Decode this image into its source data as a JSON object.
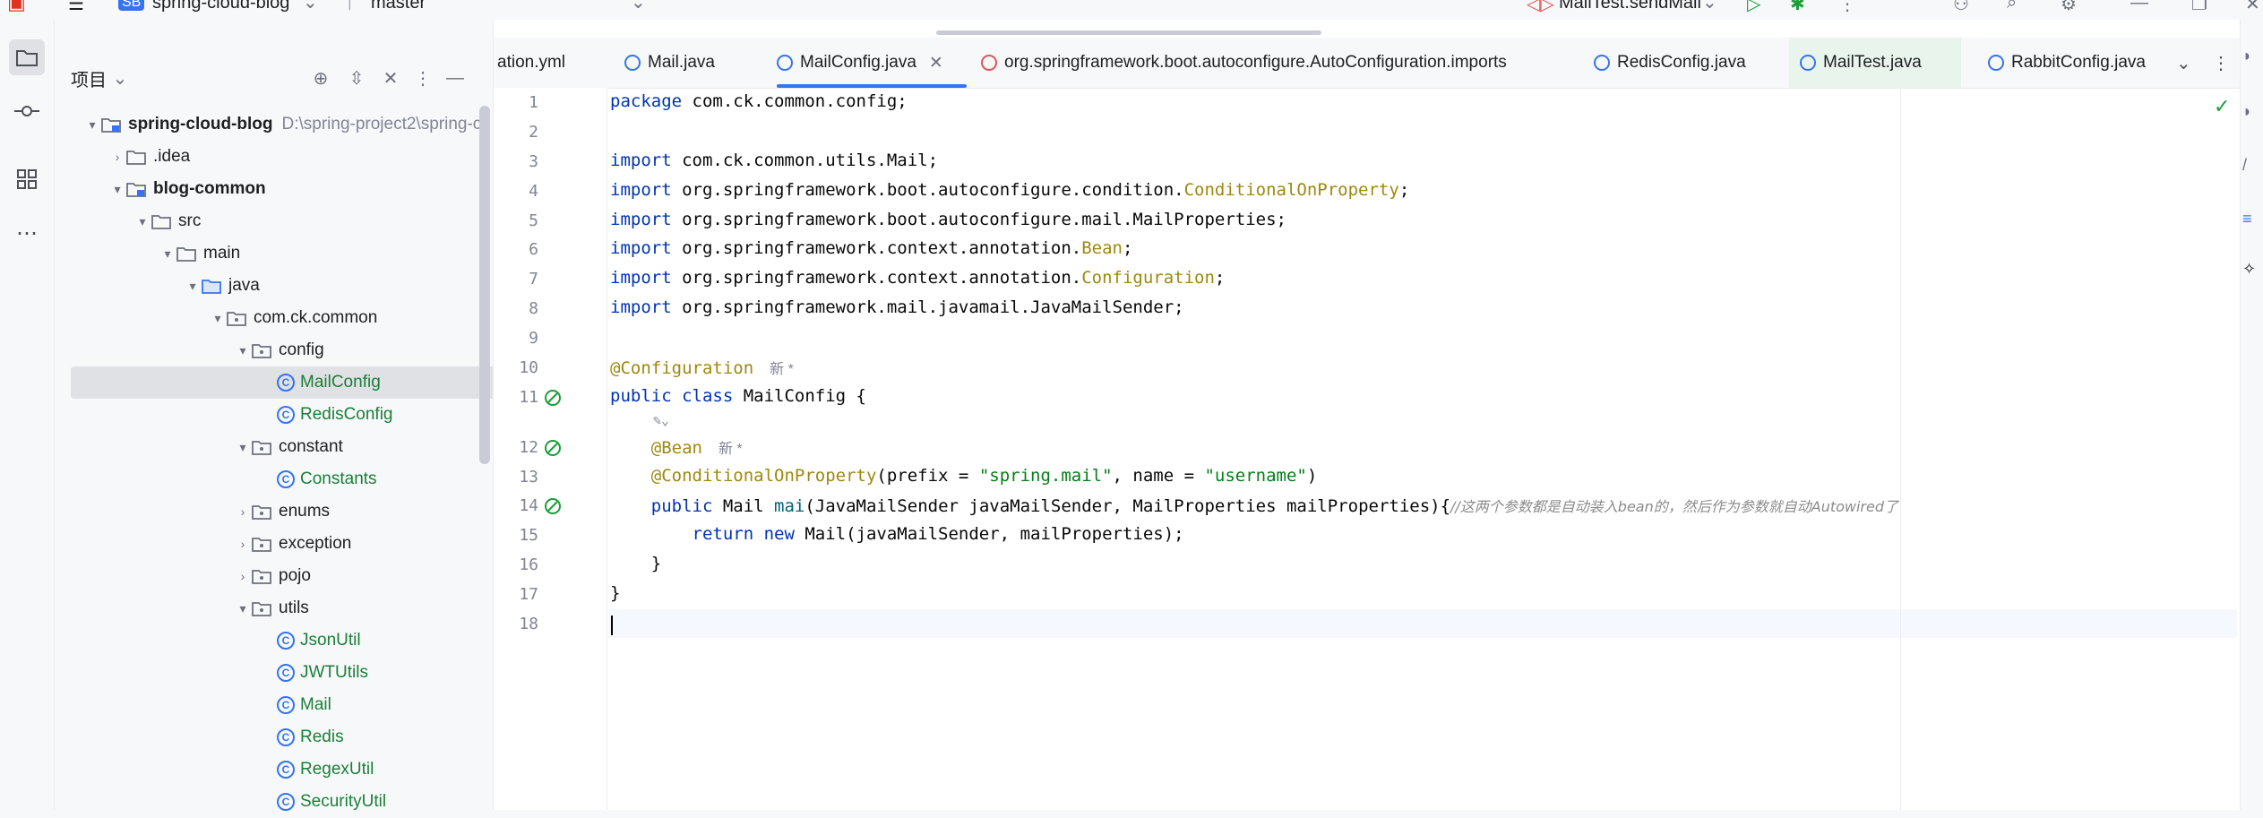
{
  "titlebar": {
    "project_badge": "SB",
    "project_name": "spring-cloud-blog",
    "branch": "master",
    "run_config": "MailTest.sendMail"
  },
  "project_panel": {
    "title": "项目",
    "tree": [
      {
        "label": "spring-cloud-blog",
        "extra": "D:\\spring-project2\\spring-c"
      },
      {
        "label": ".idea"
      },
      {
        "label": "blog-common"
      },
      {
        "label": "src"
      },
      {
        "label": "main"
      },
      {
        "label": "java"
      },
      {
        "label": "com.ck.common"
      },
      {
        "label": "config"
      },
      {
        "label": "MailConfig"
      },
      {
        "label": "RedisConfig"
      },
      {
        "label": "constant"
      },
      {
        "label": "Constants"
      },
      {
        "label": "enums"
      },
      {
        "label": "exception"
      },
      {
        "label": "pojo"
      },
      {
        "label": "utils"
      },
      {
        "label": "JsonUtil"
      },
      {
        "label": "JWTUtils"
      },
      {
        "label": "Mail"
      },
      {
        "label": "Redis"
      },
      {
        "label": "RegexUtil"
      },
      {
        "label": "SecurityUtil"
      }
    ]
  },
  "tabs": [
    {
      "label": "ation.yml"
    },
    {
      "label": "Mail.java"
    },
    {
      "label": "MailConfig.java"
    },
    {
      "label": "org.springframework.boot.autoconfigure.AutoConfiguration.imports"
    },
    {
      "label": "RedisConfig.java"
    },
    {
      "label": "MailTest.java"
    },
    {
      "label": "RabbitConfig.java"
    }
  ],
  "code": {
    "line_numbers": [
      "1",
      "2",
      "3",
      "4",
      "5",
      "6",
      "7",
      "8",
      "9",
      "10",
      "11",
      "12",
      "13",
      "14",
      "15",
      "16",
      "17",
      "18"
    ],
    "l1_kw": "package",
    "l1_rest": " com.ck.common.config;",
    "imp": "import",
    "l3": " com.ck.common.utils.Mail;",
    "l4a": " org.springframework.boot.autoconfigure.condition.",
    "l4b": "ConditionalOnProperty",
    "l4c": ";",
    "l5": " org.springframework.boot.autoconfigure.mail.MailProperties;",
    "l6a": " org.springframework.context.annotation.",
    "l6b": "Bean",
    "l6c": ";",
    "l7a": " org.springframework.context.annotation.",
    "l7b": "Configuration",
    "l7c": ";",
    "l8": " org.springframework.mail.javamail.JavaMailSender;",
    "l10": "@Configuration",
    "hint_new": "新 *",
    "l11a": "public class",
    "l11b": " MailConfig {",
    "l12": "    @Bean",
    "l13a": "    @ConditionalOnProperty",
    "l13b": "(prefix = ",
    "l13c": "\"spring.mail\"",
    "l13d": ", name = ",
    "l13e": "\"username\"",
    "l13f": ")",
    "l14a": "    public",
    "l14b": " Mail ",
    "l14c": "mai",
    "l14d": "(JavaMailSender javaMailSender, MailProperties mailProperties){",
    "l14e": "//这两个参数都是自动装入bean的，然后作为参数就自动Autowired了",
    "l15a": "        return new",
    "l15b": " Mail(javaMailSender, mailProperties);",
    "l16": "    }",
    "l17": "}"
  },
  "colors": {
    "accent": "#3574f0",
    "keyword": "#0033b3",
    "annotation": "#9e880d",
    "string": "#067d17",
    "comment": "#8c8c8c",
    "vcs_new": "#1a7f37"
  }
}
